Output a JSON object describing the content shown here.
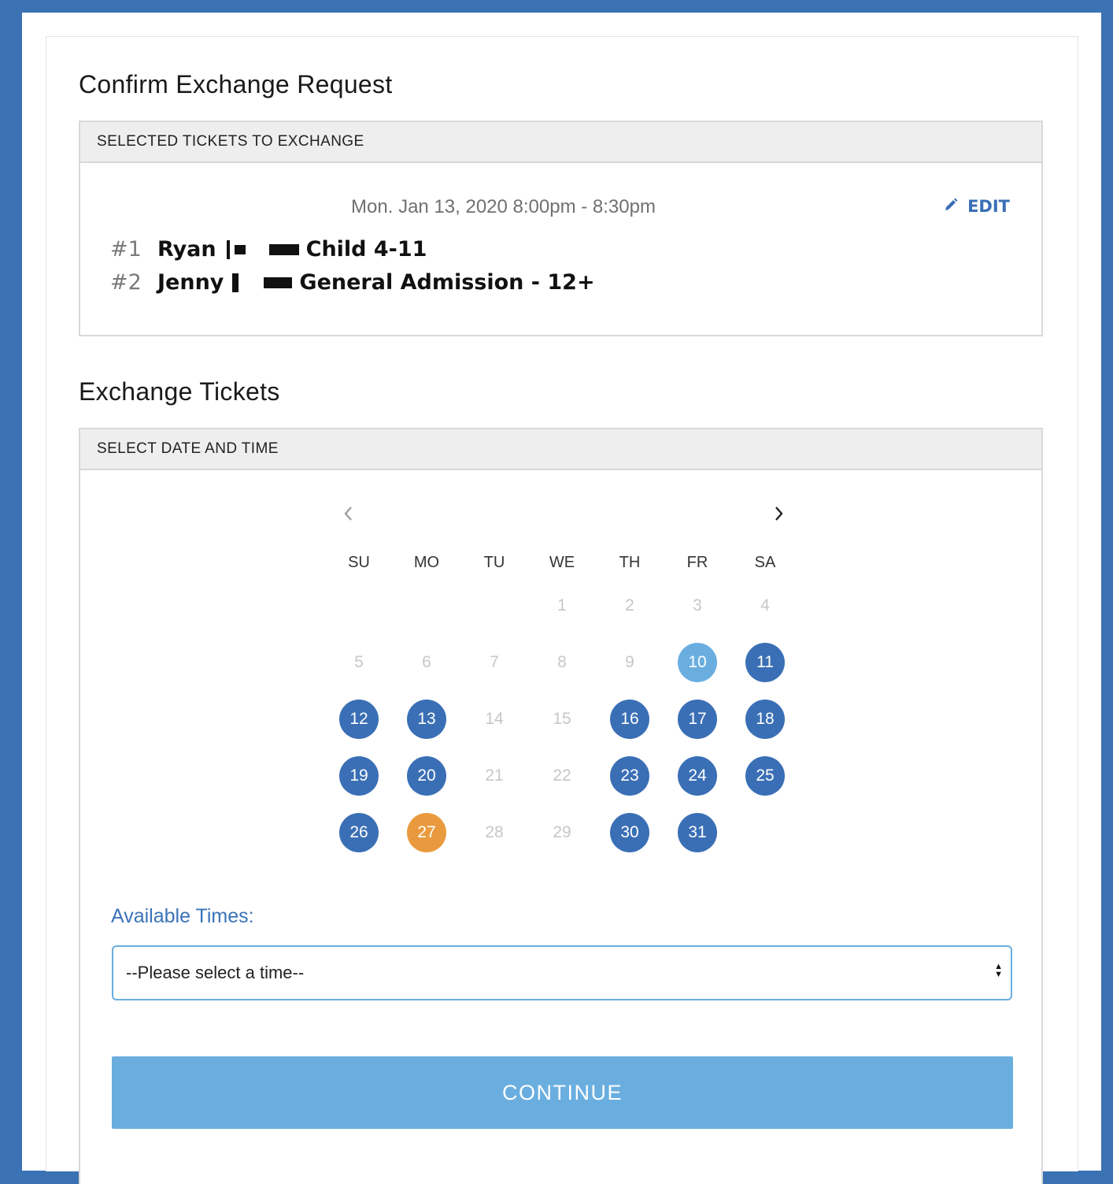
{
  "confirm": {
    "title": "Confirm Exchange Request",
    "panel_header": "SELECTED TICKETS TO EXCHANGE",
    "date_time": "Mon. Jan 13, 2020 8:00pm - 8:30pm",
    "edit_label": "EDIT",
    "tickets": [
      {
        "num": "#1",
        "name": "Ryan",
        "type": "Child 4-11"
      },
      {
        "num": "#2",
        "name": "Jenny",
        "type": "General Admission - 12+"
      }
    ]
  },
  "exchange": {
    "title": "Exchange Tickets",
    "panel_header": "SELECT DATE AND TIME",
    "weekdays": [
      "SU",
      "MO",
      "TU",
      "WE",
      "TH",
      "FR",
      "SA"
    ],
    "first_weekday_index": 3,
    "days": [
      {
        "d": "1",
        "s": "off"
      },
      {
        "d": "2",
        "s": "off"
      },
      {
        "d": "3",
        "s": "off"
      },
      {
        "d": "4",
        "s": "off"
      },
      {
        "d": "5",
        "s": "off"
      },
      {
        "d": "6",
        "s": "off"
      },
      {
        "d": "7",
        "s": "off"
      },
      {
        "d": "8",
        "s": "off"
      },
      {
        "d": "9",
        "s": "off"
      },
      {
        "d": "10",
        "s": "selected"
      },
      {
        "d": "11",
        "s": "avail"
      },
      {
        "d": "12",
        "s": "avail"
      },
      {
        "d": "13",
        "s": "avail"
      },
      {
        "d": "14",
        "s": "off"
      },
      {
        "d": "15",
        "s": "off"
      },
      {
        "d": "16",
        "s": "avail"
      },
      {
        "d": "17",
        "s": "avail"
      },
      {
        "d": "18",
        "s": "avail"
      },
      {
        "d": "19",
        "s": "avail"
      },
      {
        "d": "20",
        "s": "avail"
      },
      {
        "d": "21",
        "s": "off"
      },
      {
        "d": "22",
        "s": "off"
      },
      {
        "d": "23",
        "s": "avail"
      },
      {
        "d": "24",
        "s": "avail"
      },
      {
        "d": "25",
        "s": "avail"
      },
      {
        "d": "26",
        "s": "avail"
      },
      {
        "d": "27",
        "s": "today"
      },
      {
        "d": "28",
        "s": "off"
      },
      {
        "d": "29",
        "s": "off"
      },
      {
        "d": "30",
        "s": "avail"
      },
      {
        "d": "31",
        "s": "avail"
      }
    ],
    "times_label": "Available Times:",
    "time_select_value": "--Please select a time--",
    "continue_label": "CONTINUE"
  },
  "icons": {
    "edit": "pencil-icon",
    "prev": "chevron-left-icon",
    "next": "chevron-right-icon",
    "select": "sort-arrows-icon"
  },
  "colors": {
    "frame": "#3b72b3",
    "available_day": "#3a6fb5",
    "selected_day": "#6aaee0",
    "today_day": "#ea9a3e",
    "link": "#3a6fb7",
    "button": "#6aaee0"
  }
}
